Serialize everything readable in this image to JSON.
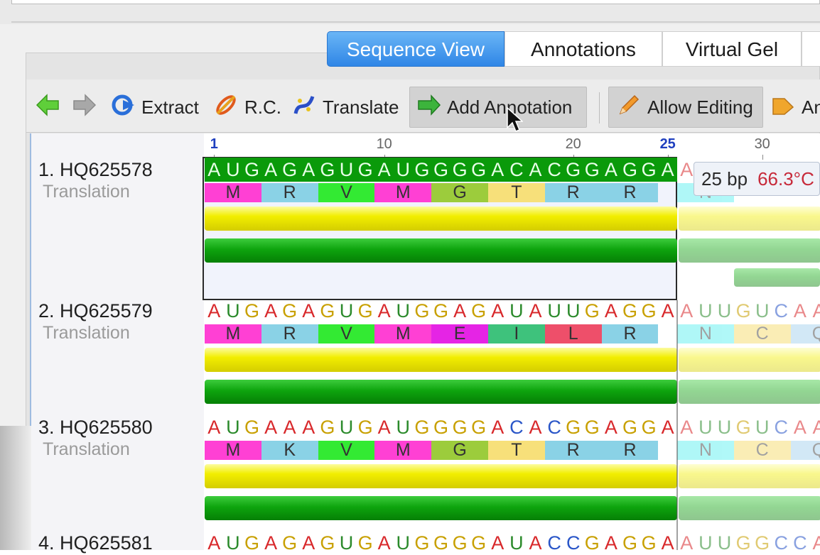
{
  "tabs": [
    {
      "label": "Sequence View",
      "active": true
    },
    {
      "label": "Annotations",
      "active": false
    },
    {
      "label": "Virtual Gel",
      "active": false
    }
  ],
  "toolbar": {
    "extract": "Extract",
    "rc": "R.C.",
    "translate": "Translate",
    "add_annotation": "Add Annotation",
    "allow_editing": "Allow Editing",
    "truncated": "An"
  },
  "ruler": {
    "ticks": [
      {
        "pos": 1,
        "label": "1",
        "selected": true
      },
      {
        "pos": 10,
        "label": "10",
        "selected": false
      },
      {
        "pos": 20,
        "label": "20",
        "selected": false
      },
      {
        "pos": 25,
        "label": "25",
        "selected": true
      },
      {
        "pos": 30,
        "label": "30",
        "selected": false
      }
    ]
  },
  "tooltip": {
    "length": "25 bp",
    "tm": "66.3°C"
  },
  "sequences": [
    {
      "name": "1. HQ625578",
      "sub": "Translation",
      "bases": "AUGAGAGUGAUGGGGACACGGAGGA",
      "tail": "A",
      "aa": [
        "M",
        "R",
        "V",
        "M",
        "G",
        "T",
        "R",
        "R"
      ],
      "tail_aa": [
        "N"
      ]
    },
    {
      "name": "2. HQ625579",
      "sub": "Translation",
      "bases": "AUGAGAGUGAUGGAGAUAUUGAGGA",
      "tail": "AUUGUCAA",
      "aa": [
        "M",
        "R",
        "V",
        "M",
        "E",
        "I",
        "L",
        "R"
      ],
      "tail_aa": [
        "N",
        "C",
        "Q"
      ]
    },
    {
      "name": "3. HQ625580",
      "sub": "Translation",
      "bases": "AUGAAAGUGAUGGGGACACGGAGGA",
      "tail": "AUUGUCAA",
      "aa": [
        "M",
        "K",
        "V",
        "M",
        "G",
        "T",
        "R",
        "R"
      ],
      "tail_aa": [
        "N",
        "C",
        "Q"
      ]
    },
    {
      "name": "4. HQ625581",
      "sub": "",
      "bases": "AUGAGAGUGAUGGGGAUACCGAGGA",
      "tail": "AUUGGCCA",
      "aa": [],
      "tail_aa": []
    }
  ],
  "colors": {
    "A": "#d8282b",
    "U": "#2b8a2b",
    "G": "#c8a000",
    "C": "#2a56c8",
    "aa": {
      "M": "#ff40d4",
      "R": "#8ad2e6",
      "K": "#8ad2e6",
      "V": "#33ea33",
      "G": "#9ccc3c",
      "T": "#f7e07a",
      "E": "#e524e5",
      "I": "#3ec27c",
      "L": "#ee4f6a",
      "N": "#6ff2f2",
      "C": "#f7e07a",
      "Q": "#aed6f0"
    },
    "selection_bases_bg": "#0a9a0a",
    "accent_tab": "#2f86e6"
  }
}
